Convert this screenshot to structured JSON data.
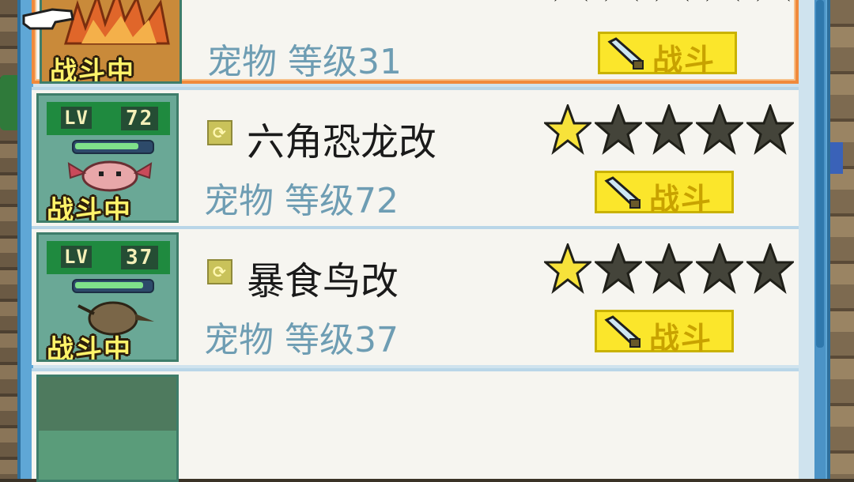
{
  "pets": [
    {
      "name": "",
      "level_text": "宠物 等级31",
      "lv_label": "",
      "lv_num": "",
      "status": "战斗中",
      "stars_filled": 0,
      "stars_total": 5,
      "action_label": "战斗",
      "selected": true
    },
    {
      "name": "六角恐龙改",
      "level_text": "宠物 等级72",
      "lv_label": "LV",
      "lv_num": "72",
      "status": "战斗中",
      "stars_filled": 1,
      "stars_total": 5,
      "action_label": "战斗",
      "selected": false
    },
    {
      "name": "暴食鸟改",
      "level_text": "宠物 等级37",
      "lv_label": "LV",
      "lv_num": "37",
      "status": "战斗中",
      "stars_filled": 1,
      "stars_total": 5,
      "action_label": "战斗",
      "selected": false
    }
  ],
  "colors": {
    "selected_border": "#f08a3c",
    "star_filled": "#f7e23a",
    "star_empty": "#44443a",
    "battle_button": "#fbe62b",
    "level_text": "#6e9db3"
  },
  "icons": {
    "pointer": "pointer-hand-icon",
    "sword": "sword-icon",
    "name_badge": "pet-type-icon",
    "star": "star-icon"
  }
}
